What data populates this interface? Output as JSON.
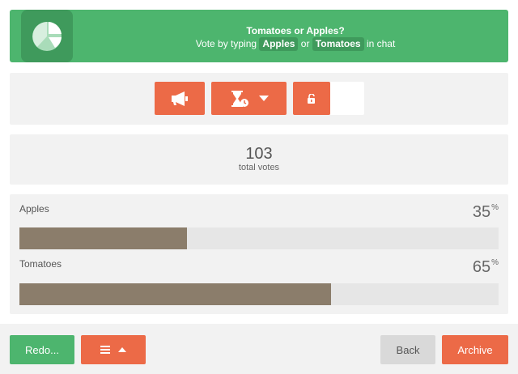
{
  "header": {
    "title": "Tomatoes or Apples?",
    "instruction_prefix": "Vote by typing",
    "keyword_1": "Apples",
    "connector": "or",
    "keyword_2": "Tomatoes",
    "instruction_suffix": "in chat",
    "logo_icon": "pie-chart-icon"
  },
  "controls": {
    "announce_icon": "megaphone-icon",
    "timer_icon": "hourglass-icon",
    "timer_dropdown_icon": "caret-down-icon",
    "lock_icon": "unlock-icon"
  },
  "totals": {
    "count": "103",
    "label": "total votes"
  },
  "results": {
    "options": [
      {
        "label": "Apples",
        "percent": "35",
        "unit": "%",
        "fraction": 0.35
      },
      {
        "label": "Tomatoes",
        "percent": "65",
        "unit": "%",
        "fraction": 0.65
      }
    ]
  },
  "footer": {
    "redo_label": "Redo...",
    "list_icon": "list-icon",
    "list_toggle_icon": "caret-up-icon",
    "back_label": "Back",
    "archive_label": "Archive"
  },
  "colors": {
    "brand_green": "#4db56e",
    "accent_orange": "#ec6a47",
    "bar_fill": "#8b7d6b",
    "panel_bg": "#f2f2f2"
  }
}
